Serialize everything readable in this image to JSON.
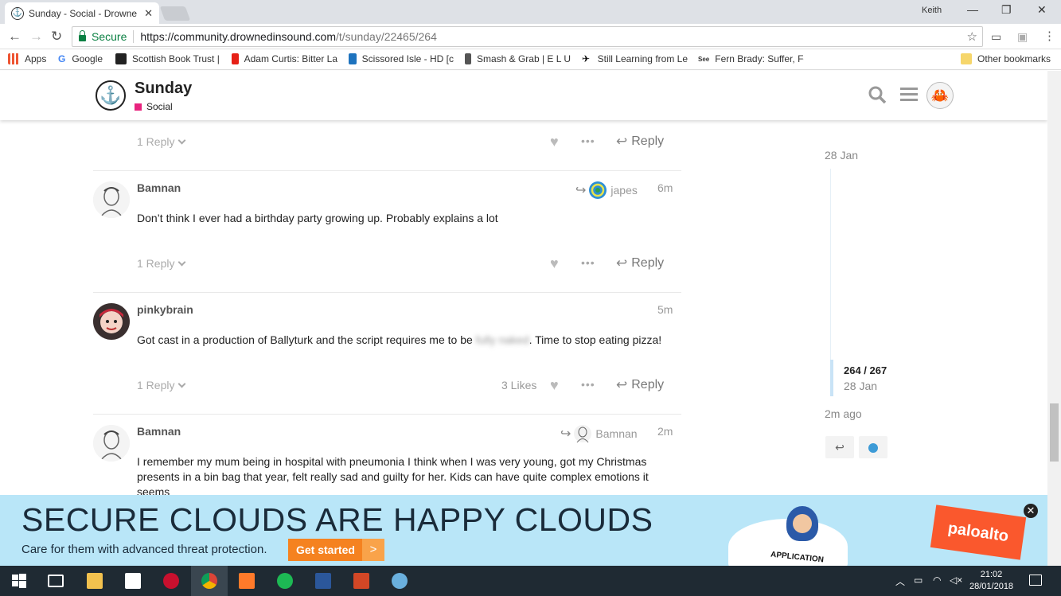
{
  "browser": {
    "tab_title": "Sunday - Social - Drowne",
    "user": "Keith",
    "secure_label": "Secure",
    "url_base": "https://community.drownedinsound.com",
    "url_path": "/t/sunday/22465/264"
  },
  "bookmarks": {
    "items": [
      "Apps",
      "Google",
      "Scottish Book Trust |",
      "Adam Curtis: Bitter La",
      "Scissored Isle - HD [c",
      "Smash & Grab | E L U",
      "Still Learning from Le",
      "Fern Brady: Suffer, Fo"
    ],
    "other": "Other bookmarks"
  },
  "header": {
    "title": "Sunday",
    "category": "Social",
    "category_color": "#e8237e"
  },
  "posts": [
    {
      "replies": "1 Reply",
      "reply_label": "Reply"
    },
    {
      "username": "Bamnan",
      "reply_to": "japes",
      "time": "6m",
      "text": "Don’t think I ever had a birthday party growing up. Probably explains a lot",
      "replies": "1 Reply",
      "reply_label": "Reply"
    },
    {
      "username": "pinkybrain",
      "time": "5m",
      "text_before": "Got cast in a production of Ballyturk and the script requires me to be",
      "text_blurred": "fully naked",
      "text_after": ". Time to stop eating pizza!",
      "replies": "1 Reply",
      "likes": "3 Likes",
      "reply_label": "Reply"
    },
    {
      "username": "Bamnan",
      "reply_to": "Bamnan",
      "time": "2m",
      "text": "I remember my mum being in hospital with pneumonia I think when I was very young, got my Christmas presents in a bin bag that year, felt really sad and guilty for her. Kids can have quite complex emotions it seems"
    }
  ],
  "timeline": {
    "start_date": "28 Jan",
    "position": "264 / 267",
    "position_date": "28 Jan",
    "end_label": "2m ago"
  },
  "ad": {
    "headline": "SECURE CLOUDS ARE HAPPY CLOUDS",
    "subtext": "Care for them with advanced threat protection.",
    "button": "Get started",
    "arrow": ">",
    "badge": "APPLICATION",
    "brand": "paloalto"
  },
  "taskbar": {
    "time": "21:02",
    "date": "28/01/2018"
  }
}
